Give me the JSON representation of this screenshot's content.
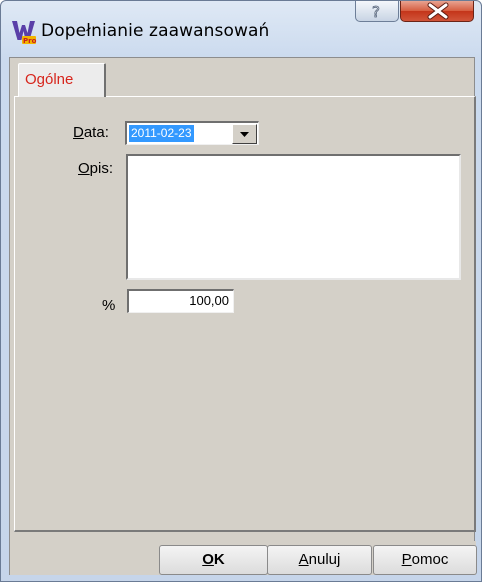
{
  "window": {
    "title": "Dopełnianie zaawansowań"
  },
  "icons": {
    "app": "app-logo-icon",
    "help": "question-mark-icon",
    "close": "close-x-icon",
    "dropdown": "chevron-down-icon"
  },
  "tabs": [
    {
      "label": "Ogólne",
      "active": true
    }
  ],
  "form": {
    "date": {
      "label_accel": "D",
      "label_rest": "ata:",
      "value": "2011-02-23"
    },
    "description": {
      "label_accel": "O",
      "label_rest": "pis:",
      "value": ""
    },
    "percent": {
      "label": "%",
      "value": "100,00"
    }
  },
  "buttons": {
    "ok": {
      "accel": "O",
      "rest": "K"
    },
    "cancel": {
      "accel": "A",
      "rest": "nuluj"
    },
    "help": {
      "accel": "P",
      "rest": "omoc"
    }
  },
  "colors": {
    "tab_label": "#d7261d",
    "selection": "#3399ff",
    "close_button": "#c4351a"
  }
}
